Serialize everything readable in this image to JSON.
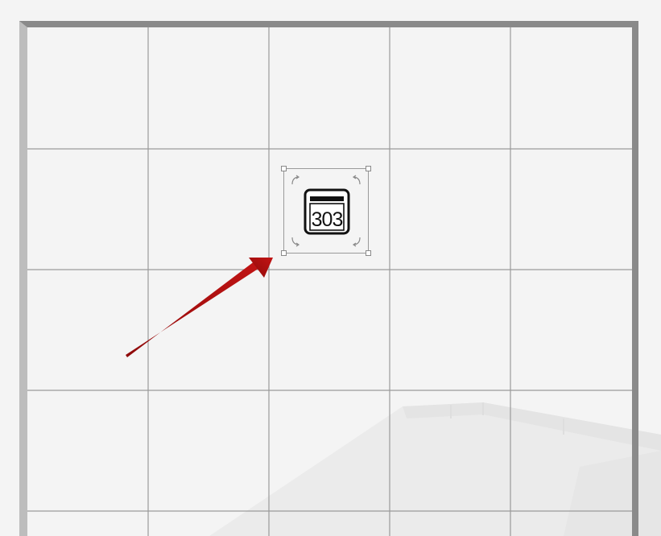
{
  "canvas": {
    "grid_visible": true,
    "background": "#f4f4f4",
    "grid_color": "#9a9a9a"
  },
  "selected_widget": {
    "icon": "room-sign-icon",
    "label": "303",
    "selected": true
  },
  "annotation": {
    "type": "pointer-arrow",
    "color": "#b00f0f"
  }
}
